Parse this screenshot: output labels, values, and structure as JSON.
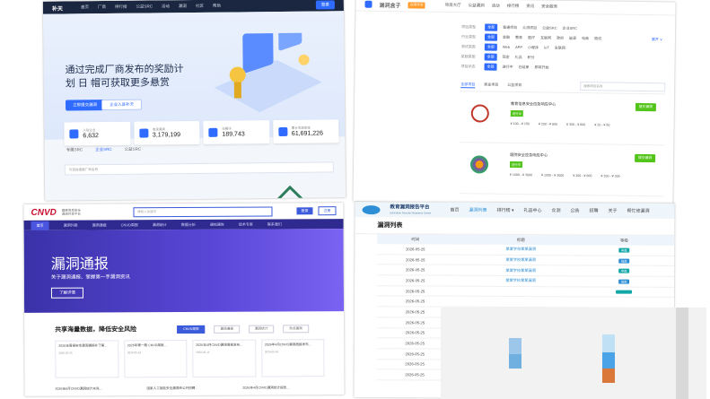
{
  "tl": {
    "logo": "补天",
    "nav": [
      "首页",
      "厂商",
      "排行榜",
      "公益SRC",
      "活动",
      "漏洞",
      "社区",
      "帮助"
    ],
    "login": "登录",
    "hero_title": "通过完成厂商发布的奖励计划 日 帽可获取更多悬赏",
    "btn_primary": "立即提交漏洞",
    "btn_secondary": "企业入驻补天",
    "stats": [
      {
        "label": "入驻企业",
        "value": "6,632"
      },
      {
        "label": "收录漏洞",
        "value": "3,179,199"
      },
      {
        "label": "白帽子",
        "value": "189,743"
      },
      {
        "label": "累计发放奖金",
        "value": "61,691,226"
      }
    ],
    "tabs": [
      "专属SRC",
      "企业SRC",
      "公益SRC"
    ],
    "search_placeholder": "可直接搜索厂商名称"
  },
  "tr": {
    "brand": "漏洞盒子",
    "badge": "众测平台",
    "nav": [
      "项目大厅",
      "公益漏洞",
      "活动",
      "排行榜",
      "资讯",
      "安全服务"
    ],
    "filters": [
      {
        "label": "项目类型",
        "tag": "全部",
        "opts": [
          "普通项目",
          "众测项目",
          "公益SRC",
          "企业SRC"
        ]
      },
      {
        "label": "行业类型",
        "tag": "全部",
        "opts": [
          "金融",
          "教育",
          "医疗",
          "互联网",
          "政府",
          "能源",
          "电商",
          "物流"
        ]
      },
      {
        "label": "测试类型",
        "tag": "全部",
        "opts": [
          "Web",
          "APP",
          "小程序",
          "IoT",
          "车联网"
        ]
      },
      {
        "label": "奖励类型",
        "tag": "全部",
        "opts": [
          "现金",
          "礼品",
          "积分"
        ]
      },
      {
        "label": "项目状态",
        "tag": "全部",
        "opts": [
          "进行中",
          "已结束",
          "即将开始"
        ]
      }
    ],
    "more": "展开 ∨",
    "tabs": [
      "全部项目",
      "奖金项目",
      "公益项目"
    ],
    "search_placeholder": "搜索项目名称",
    "items": [
      {
        "name": "教育信息安全应急响应中心",
        "tag": "进行中",
        "prices": [
          "¥ 100 - ¥ 150",
          "¥ 200 - ¥ 500",
          "¥ 300 - ¥ 600",
          "¥ 20 - ¥ 50"
        ],
        "button": "提交漏洞",
        "logo_color": "#c0392b"
      },
      {
        "name": "医院安全应急响应中心",
        "tag": "进行中",
        "prices": [
          "¥ 1000 - ¥ 3000",
          "¥ 1000 - ¥ 3000",
          "¥ 300 - ¥ 600",
          "¥ 100 - ¥ 300"
        ],
        "button": "提交漏洞",
        "logo_color": "#8e44ad"
      }
    ]
  },
  "bl": {
    "logo": "CNVD",
    "logo_sub": "国家信息安全漏洞共享平台",
    "search_placeholder": "请输入关键字",
    "login": "登录",
    "register": "注册",
    "nav": [
      "首页",
      "漏洞列表",
      "漏洞通报",
      "CNVD周报",
      "漏洞统计",
      "数据分析",
      "通知通告",
      "技术专家",
      "联系我们"
    ],
    "hero_title": "漏洞通报",
    "hero_sub": "关于漏洞通报、掌握第一手漏洞资讯",
    "hero_btn": "了解详情",
    "section_title": "共享海量数据，降低安全风险",
    "section_tabs": [
      "CNVD周报",
      "漏洞通报",
      "漏洞统计",
      "热点漏洞"
    ],
    "cards": [
      {
        "title": "2026年周报安全漏洞通报补丁第...",
        "date": "2026-05-25"
      },
      {
        "title": "2026年第一期 CNVD周报...",
        "date": "2026-05-18"
      },
      {
        "title": "2026年4月CNVD漏洞周报发布...",
        "date": "2026-05-11"
      },
      {
        "title": "2026年4月CNVD漏洞周报发布...",
        "date": "2026-05-04"
      }
    ],
    "bottom": [
      "2026年6月CNVD漏洞统计未完...",
      "国家人工智能安全漏洞库公开招聘...",
      "2026年4月CNVD漏洞统计报告..."
    ]
  },
  "br": {
    "name": "教育漏洞报告平台",
    "name_sub": "Education Security Response Center",
    "nav": [
      "首页",
      "漏洞列表",
      "排行榜 ▾",
      "礼品中心",
      "众测",
      "公告",
      "招聘",
      "关于",
      "帮忙修漏洞"
    ],
    "title": "漏洞列表",
    "columns": [
      "时间",
      "标题",
      "等级"
    ],
    "rows": [
      {
        "time": "2026-05-25",
        "title": "某某学校某某漏洞",
        "level": "中危",
        "color": "#13a8a8"
      },
      {
        "time": "2026-05-25",
        "title": "某某学校某某漏洞",
        "level": "低危",
        "color": "#2f8fd6"
      },
      {
        "time": "2026-05-25",
        "title": "某某学校某某漏洞",
        "level": "中危",
        "color": "#13a8a8"
      },
      {
        "time": "2026-05-25",
        "title": "某某学校某某漏洞",
        "level": "低危",
        "color": "#2f8fd6"
      },
      {
        "time": "2026-05-25",
        "title": "",
        "level": "",
        "color": "#13a8a8"
      },
      {
        "time": "2026-05-25",
        "title": "",
        "level": "",
        "color": ""
      },
      {
        "time": "2026-05-25",
        "title": "",
        "level": "",
        "color": ""
      },
      {
        "time": "2026-05-25",
        "title": "",
        "level": "",
        "color": ""
      },
      {
        "time": "2026-05-25",
        "title": "",
        "level": "",
        "color": ""
      },
      {
        "time": "2026-05-25",
        "title": "",
        "level": "",
        "color": ""
      },
      {
        "time": "2026-05-25",
        "title": "",
        "level": "",
        "color": ""
      },
      {
        "time": "2026-05-25",
        "title": "",
        "level": "",
        "color": ""
      },
      {
        "time": "2026-05-25",
        "title": "",
        "level": "",
        "color": ""
      }
    ]
  }
}
